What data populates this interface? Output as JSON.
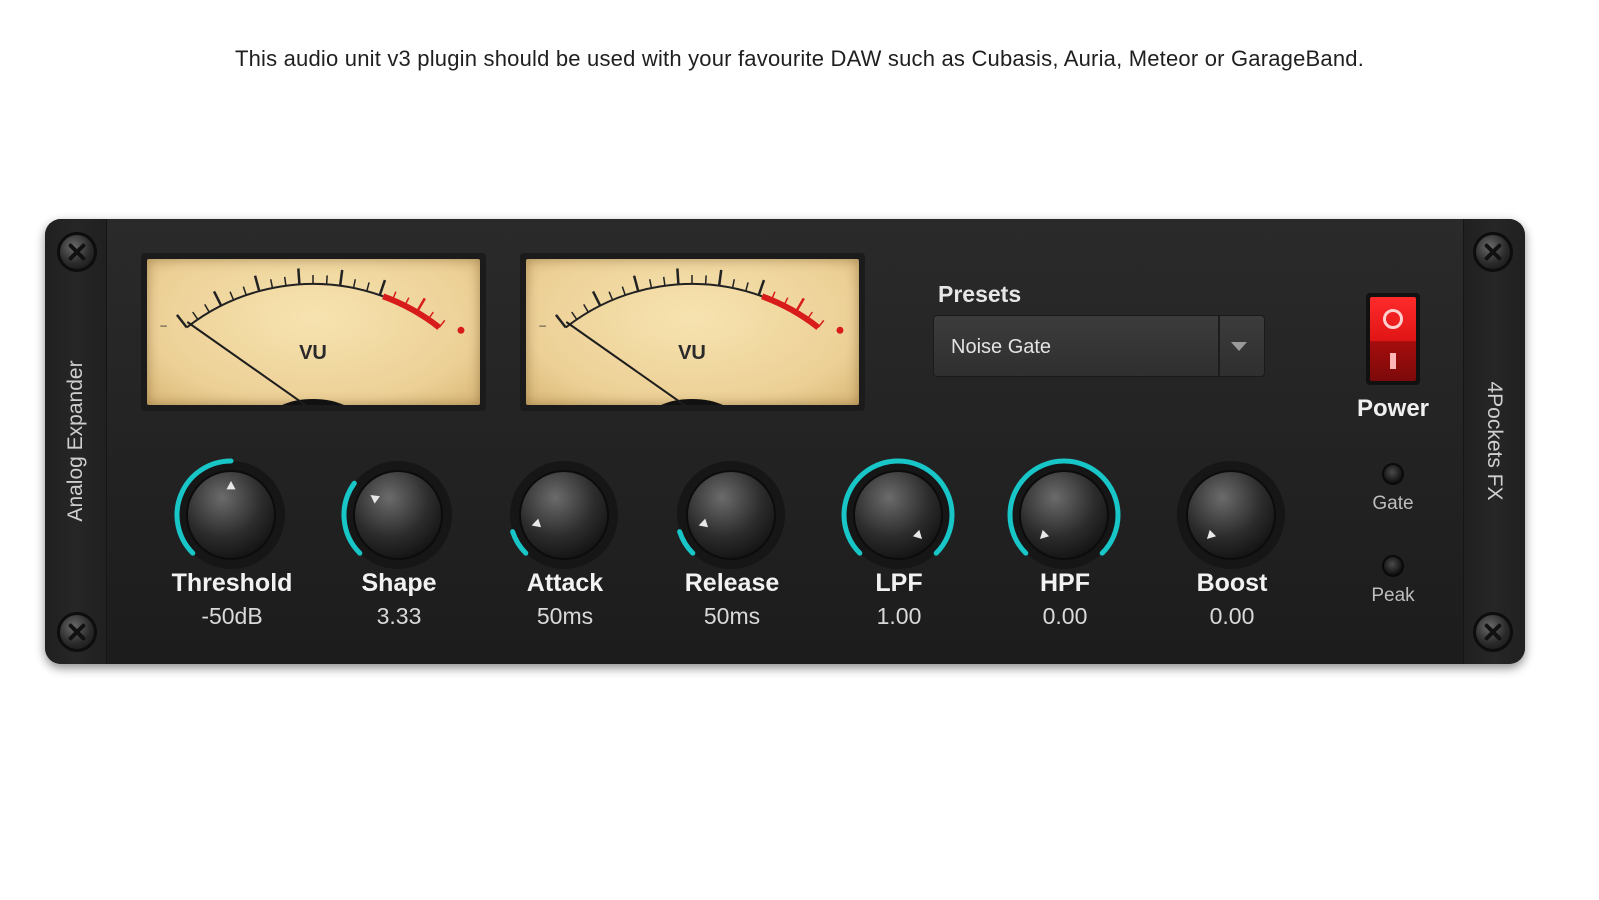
{
  "caption": "This audio unit v3 plugin should be used with your favourite DAW such as Cubasis, Auria, Meteor or GarageBand.",
  "plugin": {
    "name": "Analog Expander",
    "brand": "4Pockets FX"
  },
  "meters": [
    {
      "label": "VU",
      "needle_level": 0.04
    },
    {
      "label": "VU",
      "needle_level": 0.04
    }
  ],
  "presets": {
    "label": "Presets",
    "selected": "Noise Gate"
  },
  "power": {
    "label": "Power",
    "state": "on",
    "on_symbol": "O",
    "off_symbol": "I"
  },
  "indicators": [
    {
      "label": "Gate",
      "lit": false
    },
    {
      "label": "Peak",
      "lit": false
    }
  ],
  "knobs": [
    {
      "name": "Threshold",
      "value": "-50dB",
      "level": 0.5,
      "arc": "left"
    },
    {
      "name": "Shape",
      "value": "3.33",
      "level": 0.3,
      "arc": "left"
    },
    {
      "name": "Attack",
      "value": "50ms",
      "level": 0.1,
      "arc": "left"
    },
    {
      "name": "Release",
      "value": "50ms",
      "level": 0.1,
      "arc": "left"
    },
    {
      "name": "LPF",
      "value": "1.00",
      "level": 1.0,
      "arc": "left"
    },
    {
      "name": "HPF",
      "value": "0.00",
      "level": 0.0,
      "arc": "right"
    },
    {
      "name": "Boost",
      "value": "0.00",
      "level": 0.0,
      "arc": "none"
    }
  ],
  "colors": {
    "arc_accent": "#18c6c8",
    "meter_red": "#d81c1c",
    "meter_face": "#f2dca4"
  }
}
